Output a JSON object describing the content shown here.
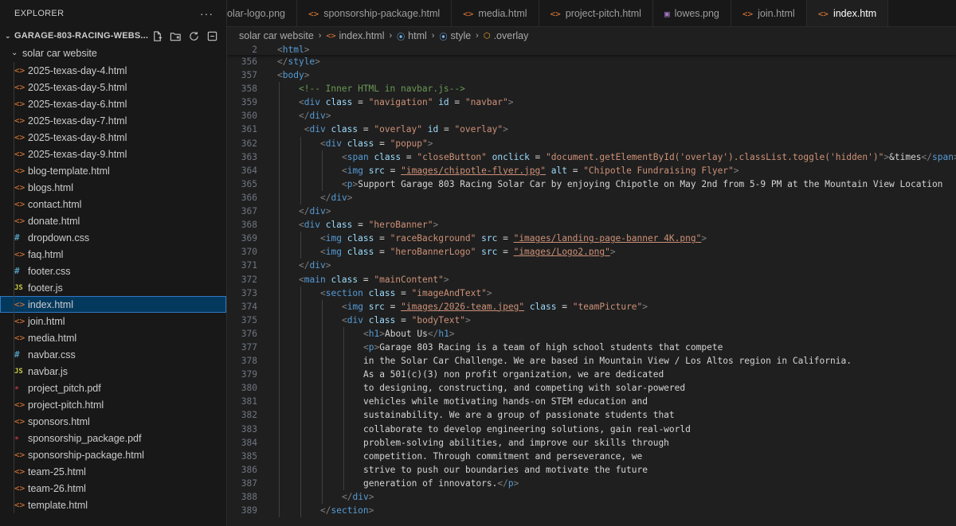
{
  "explorer": {
    "title": "EXPLORER",
    "more": "···",
    "project": "GARAGE-803-RACING-WEBS...",
    "folder": "solar car website",
    "files": [
      {
        "name": "2025-texas-day-4.html",
        "type": "html"
      },
      {
        "name": "2025-texas-day-5.html",
        "type": "html"
      },
      {
        "name": "2025-texas-day-6.html",
        "type": "html"
      },
      {
        "name": "2025-texas-day-7.html",
        "type": "html"
      },
      {
        "name": "2025-texas-day-8.html",
        "type": "html"
      },
      {
        "name": "2025-texas-day-9.html",
        "type": "html"
      },
      {
        "name": "blog-template.html",
        "type": "html"
      },
      {
        "name": "blogs.html",
        "type": "html"
      },
      {
        "name": "contact.html",
        "type": "html"
      },
      {
        "name": "donate.html",
        "type": "html"
      },
      {
        "name": "dropdown.css",
        "type": "css"
      },
      {
        "name": "faq.html",
        "type": "html"
      },
      {
        "name": "footer.css",
        "type": "css"
      },
      {
        "name": "footer.js",
        "type": "js"
      },
      {
        "name": "index.html",
        "type": "html",
        "active": true
      },
      {
        "name": "join.html",
        "type": "html"
      },
      {
        "name": "media.html",
        "type": "html"
      },
      {
        "name": "navbar.css",
        "type": "css"
      },
      {
        "name": "navbar.js",
        "type": "js"
      },
      {
        "name": "project_pitch.pdf",
        "type": "pdf"
      },
      {
        "name": "project-pitch.html",
        "type": "html"
      },
      {
        "name": "sponsors.html",
        "type": "html"
      },
      {
        "name": "sponsorship_package.pdf",
        "type": "pdf"
      },
      {
        "name": "sponsorship-package.html",
        "type": "html"
      },
      {
        "name": "team-25.html",
        "type": "html"
      },
      {
        "name": "team-26.html",
        "type": "html"
      },
      {
        "name": "template.html",
        "type": "html"
      }
    ]
  },
  "tabs": [
    {
      "label": "olar-logo.png",
      "type": "none"
    },
    {
      "label": "sponsorship-package.html",
      "type": "html"
    },
    {
      "label": "media.html",
      "type": "html"
    },
    {
      "label": "project-pitch.html",
      "type": "html"
    },
    {
      "label": "lowes.png",
      "type": "img"
    },
    {
      "label": "join.html",
      "type": "html"
    },
    {
      "label": "index.htm",
      "type": "html",
      "active": true
    }
  ],
  "breadcrumb": [
    {
      "label": "solar car website",
      "icon": ""
    },
    {
      "label": "index.html",
      "icon": "html"
    },
    {
      "label": "html",
      "icon": "sym"
    },
    {
      "label": "style",
      "icon": "sym"
    },
    {
      "label": ".overlay",
      "icon": "cls"
    }
  ],
  "sticky_line": {
    "num": "2",
    "indent": 0,
    "tokens": [
      [
        "p",
        "<"
      ],
      [
        "t",
        "html"
      ],
      [
        "p",
        ">"
      ]
    ]
  },
  "code_lines": [
    {
      "num": "356",
      "indent": 0,
      "tokens": [
        [
          "p",
          "</"
        ],
        [
          "t",
          "style"
        ],
        [
          "p",
          ">"
        ]
      ]
    },
    {
      "num": "357",
      "indent": 0,
      "tokens": [
        [
          "p",
          "<"
        ],
        [
          "t",
          "body"
        ],
        [
          "p",
          ">"
        ]
      ]
    },
    {
      "num": "358",
      "indent": 1,
      "tokens": [
        [
          "c",
          "<!-- Inner HTML in navbar.js-->"
        ]
      ]
    },
    {
      "num": "359",
      "indent": 1,
      "tokens": [
        [
          "p",
          "<"
        ],
        [
          "t",
          "div "
        ],
        [
          "a",
          "class"
        ],
        [
          "x",
          " = "
        ],
        [
          "s",
          "\"navigation\""
        ],
        [
          "x",
          " "
        ],
        [
          "a",
          "id"
        ],
        [
          "x",
          " = "
        ],
        [
          "s",
          "\"navbar\""
        ],
        [
          "p",
          ">"
        ]
      ]
    },
    {
      "num": "360",
      "indent": 1,
      "tokens": [
        [
          "p",
          "</"
        ],
        [
          "t",
          "div"
        ],
        [
          "p",
          ">"
        ]
      ]
    },
    {
      "num": "361",
      "indent": 1,
      "pad": 1,
      "tokens": [
        [
          "p",
          "<"
        ],
        [
          "t",
          "div "
        ],
        [
          "a",
          "class"
        ],
        [
          "x",
          " = "
        ],
        [
          "s",
          "\"overlay\""
        ],
        [
          "x",
          " "
        ],
        [
          "a",
          "id"
        ],
        [
          "x",
          " = "
        ],
        [
          "s",
          "\"overlay\""
        ],
        [
          "p",
          ">"
        ]
      ]
    },
    {
      "num": "362",
      "indent": 2,
      "tokens": [
        [
          "p",
          "<"
        ],
        [
          "t",
          "div "
        ],
        [
          "a",
          "class"
        ],
        [
          "x",
          " = "
        ],
        [
          "s",
          "\"popup\""
        ],
        [
          "p",
          ">"
        ]
      ]
    },
    {
      "num": "363",
      "indent": 3,
      "tokens": [
        [
          "p",
          "<"
        ],
        [
          "t",
          "span "
        ],
        [
          "a",
          "class"
        ],
        [
          "x",
          " = "
        ],
        [
          "s",
          "\"closeButton\""
        ],
        [
          "x",
          " "
        ],
        [
          "a",
          "onclick"
        ],
        [
          "x",
          " = "
        ],
        [
          "s",
          "\"document.getElementById('overlay').classList.toggle('hidden')\""
        ],
        [
          "p",
          ">"
        ],
        [
          "e",
          "&times"
        ],
        [
          "p",
          "</"
        ],
        [
          "t",
          "span"
        ],
        [
          "p",
          ">"
        ]
      ]
    },
    {
      "num": "364",
      "indent": 3,
      "tokens": [
        [
          "p",
          "<"
        ],
        [
          "t",
          "img "
        ],
        [
          "a",
          "src"
        ],
        [
          "x",
          " = "
        ],
        [
          "su",
          "\"images/chipotle-flyer.jpg\""
        ],
        [
          "x",
          " "
        ],
        [
          "a",
          "alt"
        ],
        [
          "x",
          " = "
        ],
        [
          "s",
          "\"Chipotle Fundraising Flyer\""
        ],
        [
          "p",
          ">"
        ]
      ]
    },
    {
      "num": "365",
      "indent": 3,
      "tokens": [
        [
          "p",
          "<"
        ],
        [
          "t",
          "p"
        ],
        [
          "p",
          ">"
        ],
        [
          "x",
          "Support Garage 803 Racing Solar Car by enjoying Chipotle on May 2nd from 5-9 PM at the Mountain View Location"
        ]
      ]
    },
    {
      "num": "366",
      "indent": 2,
      "tokens": [
        [
          "p",
          "</"
        ],
        [
          "t",
          "div"
        ],
        [
          "p",
          ">"
        ]
      ]
    },
    {
      "num": "367",
      "indent": 1,
      "tokens": [
        [
          "p",
          "</"
        ],
        [
          "t",
          "div"
        ],
        [
          "p",
          ">"
        ]
      ]
    },
    {
      "num": "368",
      "indent": 1,
      "tokens": [
        [
          "p",
          "<"
        ],
        [
          "t",
          "div "
        ],
        [
          "a",
          "class"
        ],
        [
          "x",
          " = "
        ],
        [
          "s",
          "\"heroBanner\""
        ],
        [
          "p",
          ">"
        ]
      ]
    },
    {
      "num": "369",
      "indent": 2,
      "tokens": [
        [
          "p",
          "<"
        ],
        [
          "t",
          "img "
        ],
        [
          "a",
          "class"
        ],
        [
          "x",
          " = "
        ],
        [
          "s",
          "\"raceBackground\""
        ],
        [
          "x",
          " "
        ],
        [
          "a",
          "src"
        ],
        [
          "x",
          " = "
        ],
        [
          "su",
          "\"images/landing-page-banner 4K.png\""
        ],
        [
          "p",
          ">"
        ]
      ]
    },
    {
      "num": "370",
      "indent": 2,
      "tokens": [
        [
          "p",
          "<"
        ],
        [
          "t",
          "img "
        ],
        [
          "a",
          "class"
        ],
        [
          "x",
          " = "
        ],
        [
          "s",
          "\"heroBannerLogo\""
        ],
        [
          "x",
          " "
        ],
        [
          "a",
          "src"
        ],
        [
          "x",
          " = "
        ],
        [
          "su",
          "\"images/Logo2.png\""
        ],
        [
          "p",
          ">"
        ]
      ]
    },
    {
      "num": "371",
      "indent": 1,
      "tokens": [
        [
          "p",
          "</"
        ],
        [
          "t",
          "div"
        ],
        [
          "p",
          ">"
        ]
      ]
    },
    {
      "num": "372",
      "indent": 1,
      "tokens": [
        [
          "p",
          "<"
        ],
        [
          "t",
          "main "
        ],
        [
          "a",
          "class"
        ],
        [
          "x",
          " = "
        ],
        [
          "s",
          "\"mainContent\""
        ],
        [
          "p",
          ">"
        ]
      ]
    },
    {
      "num": "373",
      "indent": 2,
      "tokens": [
        [
          "p",
          "<"
        ],
        [
          "t",
          "section "
        ],
        [
          "a",
          "class"
        ],
        [
          "x",
          " = "
        ],
        [
          "s",
          "\"imageAndText\""
        ],
        [
          "p",
          ">"
        ]
      ]
    },
    {
      "num": "374",
      "indent": 3,
      "tokens": [
        [
          "p",
          "<"
        ],
        [
          "t",
          "img "
        ],
        [
          "a",
          "src"
        ],
        [
          "x",
          " = "
        ],
        [
          "su",
          "\"images/2026-team.jpeg\""
        ],
        [
          "x",
          " "
        ],
        [
          "a",
          "class"
        ],
        [
          "x",
          " = "
        ],
        [
          "s",
          "\"teamPicture\""
        ],
        [
          "p",
          ">"
        ]
      ]
    },
    {
      "num": "375",
      "indent": 3,
      "tokens": [
        [
          "p",
          "<"
        ],
        [
          "t",
          "div "
        ],
        [
          "a",
          "class"
        ],
        [
          "x",
          " = "
        ],
        [
          "s",
          "\"bodyText\""
        ],
        [
          "p",
          ">"
        ]
      ]
    },
    {
      "num": "376",
      "indent": 4,
      "tokens": [
        [
          "p",
          "<"
        ],
        [
          "t",
          "h1"
        ],
        [
          "p",
          ">"
        ],
        [
          "x",
          "About Us"
        ],
        [
          "p",
          "</"
        ],
        [
          "t",
          "h1"
        ],
        [
          "p",
          ">"
        ]
      ]
    },
    {
      "num": "377",
      "indent": 4,
      "tokens": [
        [
          "p",
          "<"
        ],
        [
          "t",
          "p"
        ],
        [
          "p",
          ">"
        ],
        [
          "x",
          "Garage 803 Racing is a team of high school students that compete"
        ]
      ]
    },
    {
      "num": "378",
      "indent": 4,
      "tokens": [
        [
          "x",
          "in the Solar Car Challenge. We are based in Mountain View / Los Altos region in California."
        ]
      ]
    },
    {
      "num": "379",
      "indent": 4,
      "tokens": [
        [
          "x",
          "As a 501(c)(3) non profit organization, we are dedicated"
        ]
      ]
    },
    {
      "num": "380",
      "indent": 4,
      "tokens": [
        [
          "x",
          "to designing, constructing, and competing with solar-powered"
        ]
      ]
    },
    {
      "num": "381",
      "indent": 4,
      "tokens": [
        [
          "x",
          "vehicles while motivating hands-on STEM education and"
        ]
      ]
    },
    {
      "num": "382",
      "indent": 4,
      "tokens": [
        [
          "x",
          "sustainability. We are a group of passionate students that"
        ]
      ]
    },
    {
      "num": "383",
      "indent": 4,
      "tokens": [
        [
          "x",
          "collaborate to develop engineering solutions, gain real-world"
        ]
      ]
    },
    {
      "num": "384",
      "indent": 4,
      "tokens": [
        [
          "x",
          "problem-solving abilities, and improve our skills through"
        ]
      ]
    },
    {
      "num": "385",
      "indent": 4,
      "tokens": [
        [
          "x",
          "competition. Through commitment and perseverance, we"
        ]
      ]
    },
    {
      "num": "386",
      "indent": 4,
      "tokens": [
        [
          "x",
          "strive to push our boundaries and motivate the future"
        ]
      ]
    },
    {
      "num": "387",
      "indent": 4,
      "tokens": [
        [
          "x",
          "generation of innovators."
        ],
        [
          "p",
          "</"
        ],
        [
          "t",
          "p"
        ],
        [
          "p",
          ">"
        ]
      ]
    },
    {
      "num": "388",
      "indent": 3,
      "tokens": [
        [
          "p",
          "</"
        ],
        [
          "t",
          "div"
        ],
        [
          "p",
          ">"
        ]
      ]
    },
    {
      "num": "389",
      "indent": 2,
      "tokens": [
        [
          "p",
          "</"
        ],
        [
          "t",
          "section"
        ],
        [
          "p",
          ">"
        ]
      ]
    }
  ],
  "colors": {
    "tag": "#569cd6",
    "attr": "#9cdcfe",
    "string": "#ce9178",
    "comment": "#6a9955",
    "active_file_bg": "#04395e"
  }
}
